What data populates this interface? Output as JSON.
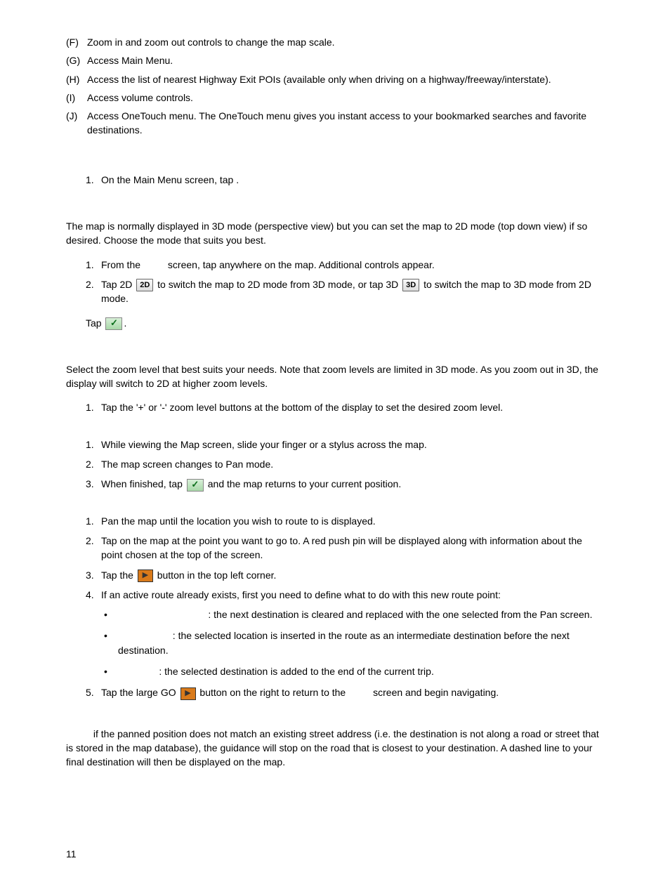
{
  "letters": [
    {
      "label": "(F)",
      "text": "Zoom in and zoom out controls to change the map scale."
    },
    {
      "label": "(G)",
      "text": "Access Main Menu."
    },
    {
      "label": "(H)",
      "text": "Access the list of nearest Highway Exit POIs (available only when driving on a highway/freeway/interstate)."
    },
    {
      "label": "(I)",
      "text": "Access volume controls."
    },
    {
      "label": "(J)",
      "text": "Access OneTouch menu. The OneTouch menu gives you instant access to your bookmarked searches and favorite destinations."
    }
  ],
  "main_menu_step": {
    "label": "1.",
    "text": "On the Main Menu screen, tap                       ."
  },
  "mode_para": "The map is normally displayed in 3D mode (perspective view) but you can set the map to 2D mode (top down view) if so desired. Choose the mode that suits you best.",
  "mode_steps": {
    "s1_pre": "From the",
    "s1_post": " screen, tap anywhere on the map. Additional controls appear.",
    "s2_pre": "Tap 2D ",
    "s2_mid": " to switch the map to 2D mode from 3D mode, or tap 3D ",
    "s2_post": " to switch the map to 3D mode from 2D mode."
  },
  "tap_check": "Tap ",
  "icon_labels": {
    "two_d": "2D",
    "three_d": "3D",
    "check": "✓",
    "go": "▶"
  },
  "zoom_para": "Select the zoom level that best suits your needs.  Note that zoom levels are limited in 3D mode.  As you zoom out in 3D, the display will switch to 2D at higher zoom levels.",
  "zoom_step": "Tap the '+' or '-' zoom level buttons at the bottom of the display to set the desired zoom level.",
  "pan_steps": {
    "s1": "While viewing the Map screen, slide your finger or a stylus across the map.",
    "s2": "The map screen changes to Pan mode.",
    "s3_pre": "When finished, tap ",
    "s3_post": " and the map returns to your current position."
  },
  "route_steps": {
    "s1": "Pan the map until the location you wish to route to is displayed.",
    "s2": "Tap on the map at the point you want to go to.  A red push pin will be displayed along with information about the point chosen at the top of the screen.",
    "s3_pre": "Tap the ",
    "s3_post": " button in the top left corner.",
    "s4": "If an active route already exists, first you need to define what to do with this new route point:",
    "s5_pre": "Tap the large GO ",
    "s5_mid": " button on the right to return to the ",
    "s5_post": " screen and begin navigating."
  },
  "route_bullets": {
    "b1": ": the next destination is cleared and replaced with the one selected from the Pan screen.",
    "b2": ": the selected location is inserted in the route as an intermediate destination before the next destination.",
    "b3": ": the selected destination is added to the end of the current trip."
  },
  "note_para": " if the panned position does not match an existing street address (i.e. the destination is not along a road or street that is stored in the map database), the guidance will stop on the road that is closest to your destination. A dashed line to your final destination will then be displayed on the map.",
  "page_number": "11"
}
